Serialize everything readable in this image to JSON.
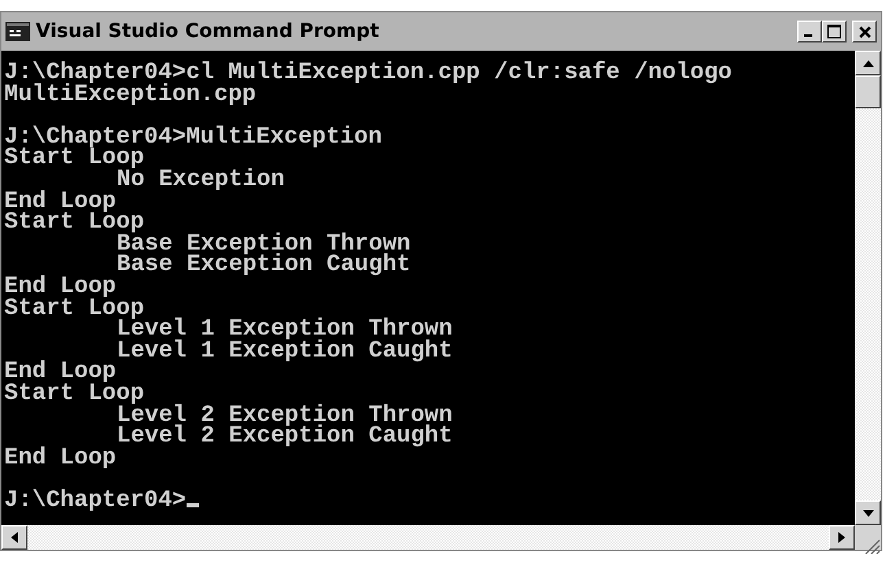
{
  "window": {
    "title": "Visual Studio Command Prompt"
  },
  "console": {
    "lines": [
      {
        "kind": "plain",
        "text": "J:\\Chapter04>cl MultiException.cpp /clr:safe /nologo"
      },
      {
        "kind": "plain",
        "text": "MultiException.cpp"
      },
      {
        "kind": "blank"
      },
      {
        "kind": "plain",
        "text": "J:\\Chapter04>MultiException"
      },
      {
        "kind": "plain",
        "text": "Start Loop"
      },
      {
        "kind": "indented",
        "text": "No Exception"
      },
      {
        "kind": "plain",
        "text": "End Loop"
      },
      {
        "kind": "plain",
        "text": "Start Loop"
      },
      {
        "kind": "indented",
        "text": "Base Exception Thrown"
      },
      {
        "kind": "indented",
        "text": "Base Exception Caught"
      },
      {
        "kind": "plain",
        "text": "End Loop"
      },
      {
        "kind": "plain",
        "text": "Start Loop"
      },
      {
        "kind": "indented",
        "text": "Level 1 Exception Thrown"
      },
      {
        "kind": "indented",
        "text": "Level 1 Exception Caught"
      },
      {
        "kind": "plain",
        "text": "End Loop"
      },
      {
        "kind": "plain",
        "text": "Start Loop"
      },
      {
        "kind": "indented",
        "text": "Level 2 Exception Thrown"
      },
      {
        "kind": "indented",
        "text": "Level 2 Exception Caught"
      },
      {
        "kind": "plain",
        "text": "End Loop"
      },
      {
        "kind": "blank"
      },
      {
        "kind": "prompt",
        "text": "J:\\Chapter04>"
      }
    ]
  }
}
